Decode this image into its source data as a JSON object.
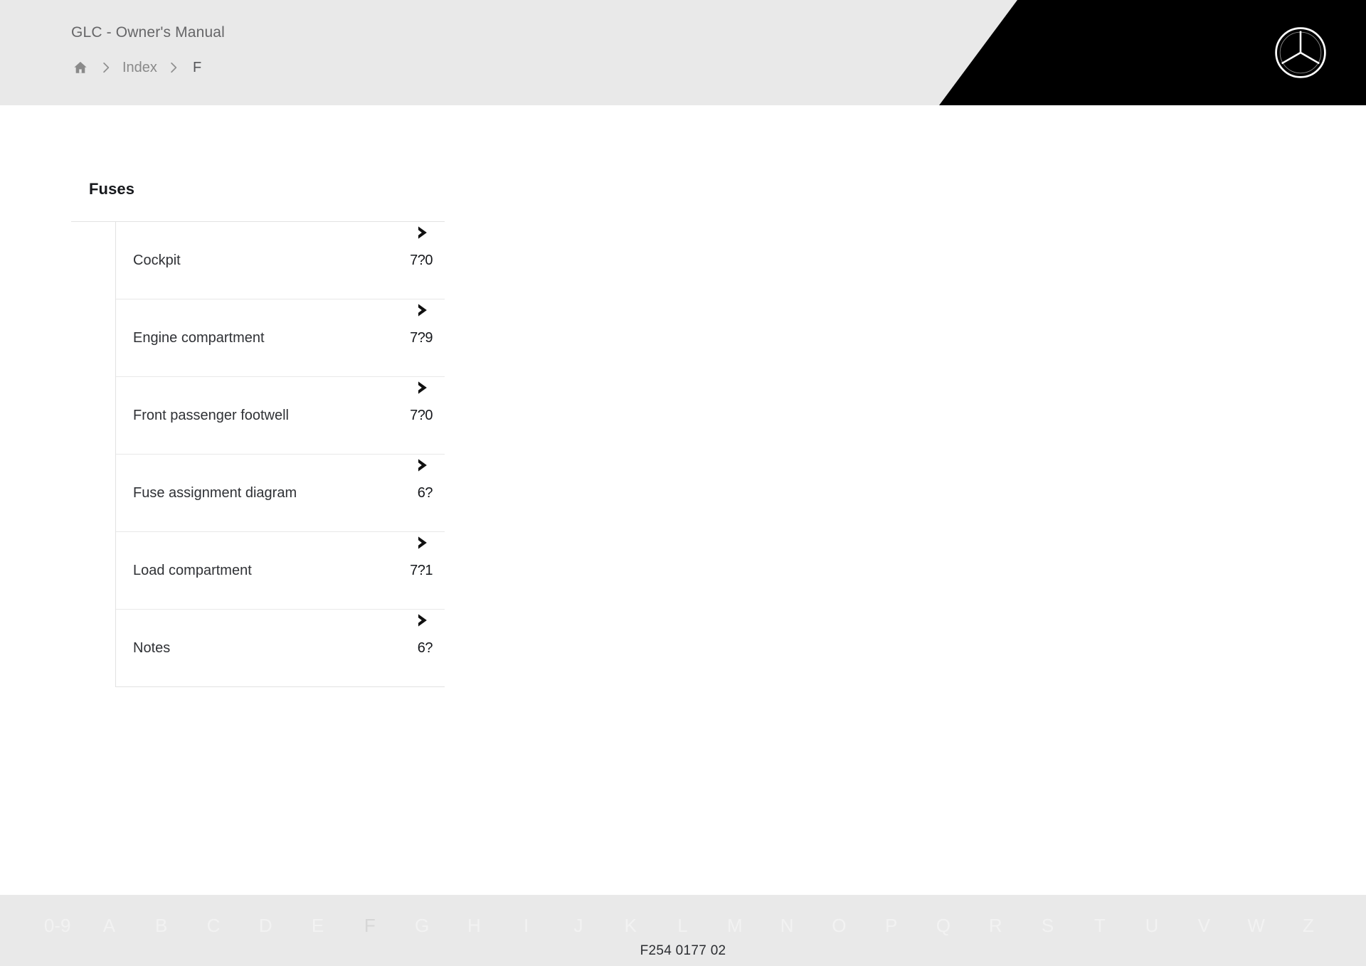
{
  "header": {
    "manual_title": "GLC - Owner's Manual",
    "home_icon": "home-icon",
    "separator_icon": "chevron-right-icon",
    "breadcrumb": [
      {
        "label": "Index",
        "current": false
      },
      {
        "label": "F",
        "current": true
      }
    ],
    "brand_logo": "mercedes-benz-star-logo",
    "bg_color": "#e9e9e9",
    "panel_color": "#000000"
  },
  "main": {
    "section_title": "Fuses",
    "entries": [
      {
        "label": "Cockpit",
        "page": "7?0",
        "arrow_icon": "arrow-right-icon"
      },
      {
        "label": "Engine compartment",
        "page": "7?9",
        "arrow_icon": "arrow-right-icon"
      },
      {
        "label": "Front passenger footwell",
        "page": "7?0",
        "arrow_icon": "arrow-right-icon"
      },
      {
        "label": "Fuse assignment diagram",
        "page": "6?",
        "arrow_icon": "arrow-right-icon"
      },
      {
        "label": "Load compartment",
        "page": "7?1",
        "arrow_icon": "arrow-right-icon"
      },
      {
        "label": "Notes",
        "page": "6?",
        "arrow_icon": "arrow-right-icon"
      }
    ]
  },
  "footer": {
    "alphabet": [
      {
        "label": "0-9",
        "active": false
      },
      {
        "label": "A",
        "active": false
      },
      {
        "label": "B",
        "active": false
      },
      {
        "label": "C",
        "active": false
      },
      {
        "label": "D",
        "active": false
      },
      {
        "label": "E",
        "active": false
      },
      {
        "label": "F",
        "active": true
      },
      {
        "label": "G",
        "active": false
      },
      {
        "label": "H",
        "active": false
      },
      {
        "label": "I",
        "active": false
      },
      {
        "label": "J",
        "active": false
      },
      {
        "label": "K",
        "active": false
      },
      {
        "label": "L",
        "active": false
      },
      {
        "label": "M",
        "active": false
      },
      {
        "label": "N",
        "active": false
      },
      {
        "label": "O",
        "active": false
      },
      {
        "label": "P",
        "active": false
      },
      {
        "label": "Q",
        "active": false
      },
      {
        "label": "R",
        "active": false
      },
      {
        "label": "S",
        "active": false
      },
      {
        "label": "T",
        "active": false
      },
      {
        "label": "U",
        "active": false
      },
      {
        "label": "V",
        "active": false
      },
      {
        "label": "W",
        "active": false
      },
      {
        "label": "Z",
        "active": false
      }
    ],
    "document_code": "F254 0177 02"
  }
}
